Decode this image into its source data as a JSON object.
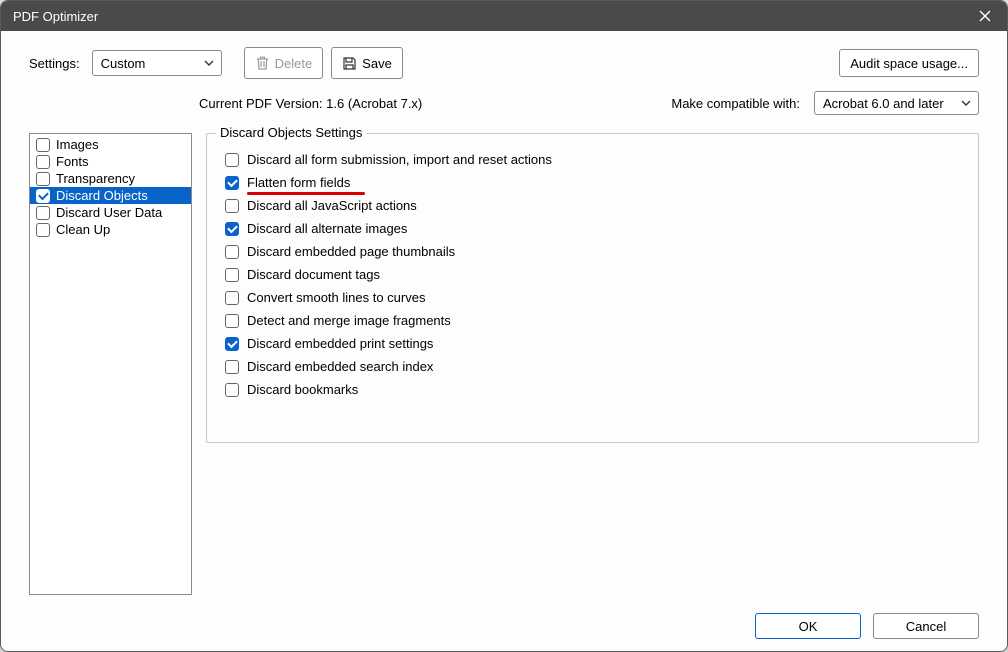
{
  "title": "PDF Optimizer",
  "toolbar": {
    "settings_label": "Settings:",
    "preset_value": "Custom",
    "delete_label": "Delete",
    "save_label": "Save",
    "audit_label": "Audit space usage..."
  },
  "info": {
    "current_version_label": "Current PDF Version: 1.6 (Acrobat 7.x)",
    "compat_label": "Make compatible with:",
    "compat_value": "Acrobat 6.0 and later"
  },
  "categories": [
    {
      "label": "Images",
      "checked": false,
      "selected": false
    },
    {
      "label": "Fonts",
      "checked": false,
      "selected": false
    },
    {
      "label": "Transparency",
      "checked": false,
      "selected": false
    },
    {
      "label": "Discard Objects",
      "checked": true,
      "selected": true
    },
    {
      "label": "Discard User Data",
      "checked": false,
      "selected": false
    },
    {
      "label": "Clean Up",
      "checked": false,
      "selected": false
    }
  ],
  "panel": {
    "legend": "Discard Objects Settings",
    "options": [
      {
        "label": "Discard all form submission, import and reset actions",
        "checked": false
      },
      {
        "label": "Flatten form fields",
        "checked": true,
        "highlight": true
      },
      {
        "label": "Discard all JavaScript actions",
        "checked": false
      },
      {
        "label": "Discard all alternate images",
        "checked": true
      },
      {
        "label": "Discard embedded page thumbnails",
        "checked": false
      },
      {
        "label": "Discard document tags",
        "checked": false
      },
      {
        "label": "Convert smooth lines to curves",
        "checked": false
      },
      {
        "label": "Detect and merge image fragments",
        "checked": false
      },
      {
        "label": "Discard embedded print settings",
        "checked": true
      },
      {
        "label": "Discard embedded search index",
        "checked": false
      },
      {
        "label": "Discard bookmarks",
        "checked": false
      }
    ]
  },
  "footer": {
    "ok_label": "OK",
    "cancel_label": "Cancel"
  }
}
